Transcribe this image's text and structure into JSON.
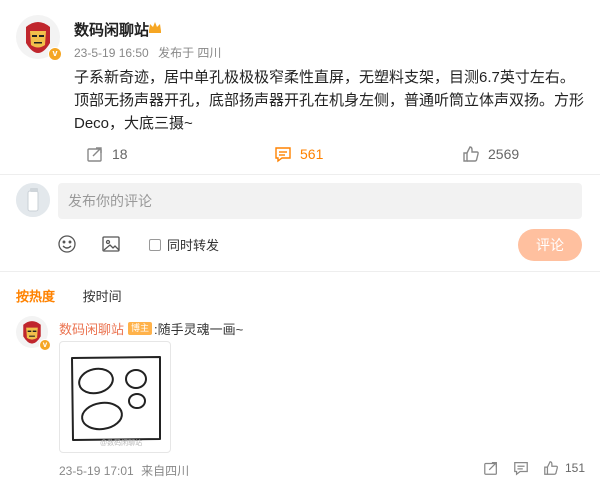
{
  "post": {
    "author": "数码闲聊站",
    "time": "23-5-19 16:50",
    "source": "发布于 四川",
    "text": "子系新奇迹，居中单孔极极极窄柔性直屏，无塑料支架，目测6.7英寸左右。顶部无扬声器开孔，底部扬声器开孔在机身左侧，普通听筒立体声双扬。方形Deco，大底三摄~",
    "reposts": "18",
    "comments": "561",
    "likes": "2569"
  },
  "composer": {
    "placeholder": "发布你的评论",
    "repost_label": "同时转发",
    "submit_label": "评论"
  },
  "sort": {
    "hot": "按热度",
    "time": "按时间"
  },
  "comment": {
    "author": "数码闲聊站",
    "tag": "博主",
    "text": ":随手灵魂一画~",
    "watermark": "@数码闲聊站",
    "time": "23-5-19 17:01",
    "location": "来自四川",
    "likes": "151"
  },
  "colors": {
    "accent": "#ff8200",
    "name_link": "#eb7350",
    "submit_disabled": "#ffc09f",
    "verified_badge": "#f5a623"
  },
  "icons": [
    "repost-icon",
    "comment-icon",
    "like-icon",
    "emoji-icon",
    "image-icon",
    "crown-icon",
    "verified-badge-icon"
  ]
}
